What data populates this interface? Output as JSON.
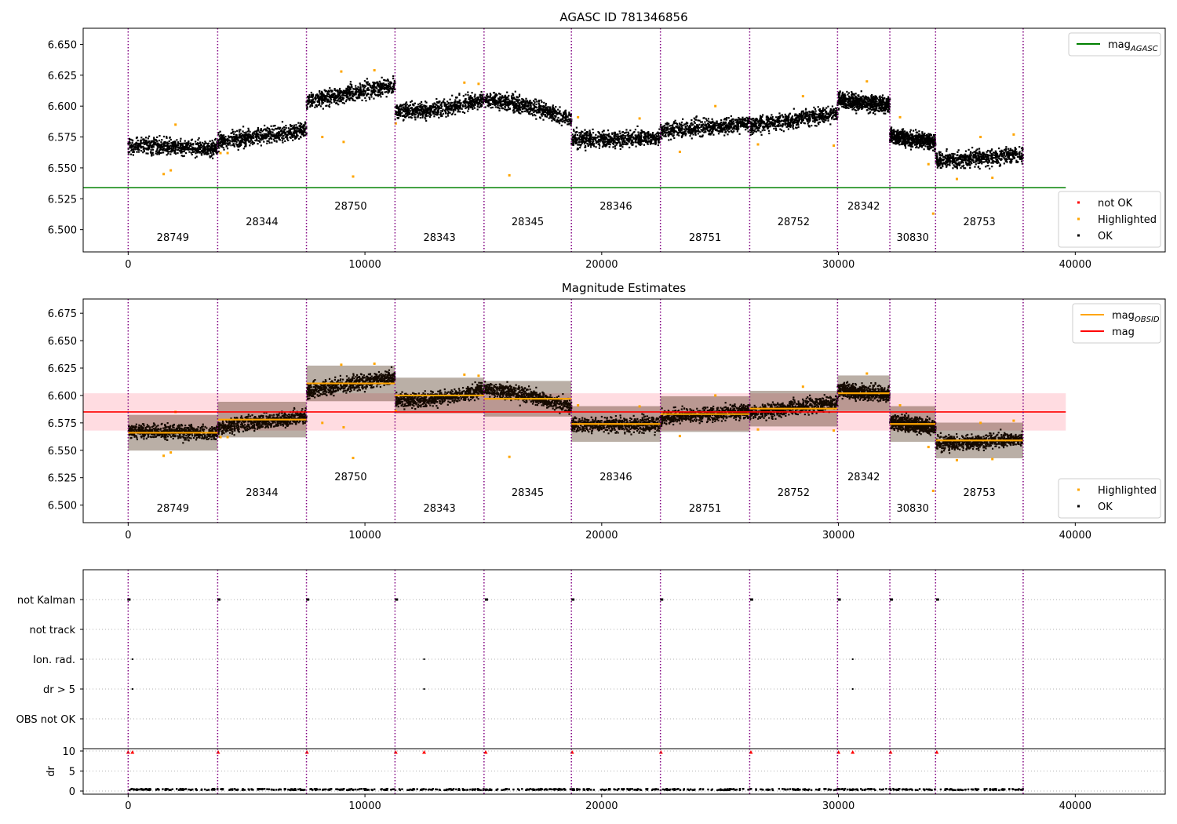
{
  "chart_data": [
    {
      "type": "scatter",
      "title": "AGASC ID 781346856",
      "xlim": [
        -1900,
        43800
      ],
      "ylim": [
        6.482,
        6.663
      ],
      "xticks": [
        0,
        10000,
        20000,
        30000,
        40000
      ],
      "yticks": [
        6.5,
        6.525,
        6.55,
        6.575,
        6.6,
        6.625,
        6.65
      ],
      "legend_upper": [
        {
          "label": "mag",
          "sub": "AGASC",
          "color": "#008000",
          "marker": "line"
        }
      ],
      "legend_lower": [
        {
          "label": "not OK",
          "color": "#ff0000",
          "marker": "dot"
        },
        {
          "label": "Highlighted",
          "color": "#ffa500",
          "marker": "dot"
        },
        {
          "label": "OK",
          "color": "#000000",
          "marker": "dot"
        }
      ],
      "reference_line": {
        "series": "mag_AGASC",
        "value": 6.534,
        "x_range": [
          -1900,
          39600
        ],
        "color": "#008000"
      }
    },
    {
      "type": "scatter",
      "title": "Magnitude Estimates",
      "xlim": [
        -1900,
        43800
      ],
      "ylim": [
        6.484,
        6.688
      ],
      "xticks": [
        0,
        10000,
        20000,
        30000,
        40000
      ],
      "yticks": [
        6.5,
        6.525,
        6.55,
        6.575,
        6.6,
        6.625,
        6.65,
        6.675
      ],
      "legend_upper": [
        {
          "label": "mag",
          "sub": "OBSID",
          "color": "#ffa500",
          "marker": "line"
        },
        {
          "label": "mag",
          "sub": "",
          "color": "#ff0000",
          "marker": "line"
        }
      ],
      "legend_lower": [
        {
          "label": "Highlighted",
          "color": "#ffa500",
          "marker": "dot"
        },
        {
          "label": "OK",
          "color": "#000000",
          "marker": "dot"
        }
      ],
      "mean_mag": {
        "value": 6.585,
        "band": [
          6.568,
          6.602
        ],
        "x_range": [
          -1900,
          39600
        ],
        "color": "#ff0000",
        "band_color": "#ffc0c8"
      }
    },
    {
      "type": "scatter",
      "title": "",
      "xlim": [
        -1900,
        43800
      ],
      "flag_labels": [
        "not Kalman",
        "not track",
        "Ion. rad.",
        "dr > 5",
        "OBS not OK"
      ],
      "dr_label": "dr",
      "dr_yticks": [
        0,
        5,
        10
      ],
      "xticks": [
        0,
        10000,
        20000,
        30000,
        40000
      ],
      "flags_not_kalman_x": [
        0,
        3800,
        7550,
        11300,
        15100,
        18750,
        22500,
        26300,
        30000,
        32200,
        34150
      ],
      "flags_ion_rad_x": [
        180,
        12500,
        30600
      ],
      "flags_dr_gt5_x": [
        180,
        12500,
        30600
      ],
      "dr_high_points_x": [
        0,
        180,
        3800,
        7550,
        11300,
        12500,
        15100,
        18750,
        22500,
        26300,
        30000,
        30600,
        32200,
        34150
      ]
    }
  ],
  "obsids": [
    {
      "id": "28749",
      "start": 0,
      "end": 3780,
      "mag": 6.566,
      "y0": 6.568,
      "y1": 6.566,
      "curve": 0,
      "spread": 0.0065,
      "label_level": 0
    },
    {
      "id": "28344",
      "start": 3780,
      "end": 7530,
      "mag": 6.578,
      "y0": 6.571,
      "y1": 6.581,
      "curve": 0,
      "spread": 0.0065,
      "label_level": 1
    },
    {
      "id": "28750",
      "start": 7530,
      "end": 11270,
      "mag": 6.611,
      "y0": 6.604,
      "y1": 6.617,
      "curve": 0,
      "spread": 0.0065,
      "label_level": 2
    },
    {
      "id": "28343",
      "start": 11270,
      "end": 15030,
      "mag": 6.6,
      "y0": 6.596,
      "y1": 6.606,
      "curve": -0.003,
      "spread": 0.0065,
      "label_level": 0
    },
    {
      "id": "28345",
      "start": 15030,
      "end": 18720,
      "mag": 6.597,
      "y0": 6.605,
      "y1": 6.589,
      "curve": 0.003,
      "spread": 0.0065,
      "label_level": 1
    },
    {
      "id": "28346",
      "start": 18720,
      "end": 22480,
      "mag": 6.574,
      "y0": 6.573,
      "y1": 6.574,
      "curve": 0,
      "spread": 0.0065,
      "label_level": 2
    },
    {
      "id": "28751",
      "start": 22480,
      "end": 26250,
      "mag": 6.583,
      "y0": 6.58,
      "y1": 6.586,
      "curve": 0,
      "spread": 0.0065,
      "label_level": 0
    },
    {
      "id": "28752",
      "start": 26250,
      "end": 29960,
      "mag": 6.588,
      "y0": 6.584,
      "y1": 6.594,
      "curve": 0,
      "spread": 0.0065,
      "label_level": 1
    },
    {
      "id": "28342",
      "start": 29960,
      "end": 32170,
      "mag": 6.602,
      "y0": 6.605,
      "y1": 6.601,
      "curve": 0,
      "spread": 0.0065,
      "label_level": 2
    },
    {
      "id": "30830",
      "start": 32170,
      "end": 34100,
      "mag": 6.574,
      "y0": 6.576,
      "y1": 6.571,
      "curve": 0,
      "spread": 0.0065,
      "label_level": 0
    },
    {
      "id": "28753",
      "start": 34100,
      "end": 37800,
      "mag": 6.559,
      "y0": 6.556,
      "y1": 6.56,
      "curve": 0,
      "spread": 0.0065,
      "label_level": 1
    }
  ],
  "highlighted_points": [
    [
      1500,
      6.545
    ],
    [
      1800,
      6.548
    ],
    [
      2000,
      6.585
    ],
    [
      3900,
      6.562
    ],
    [
      4200,
      6.562
    ],
    [
      8200,
      6.575
    ],
    [
      9100,
      6.571
    ],
    [
      9500,
      6.543
    ],
    [
      9000,
      6.628
    ],
    [
      10400,
      6.629
    ],
    [
      11300,
      6.586
    ],
    [
      14200,
      6.619
    ],
    [
      14800,
      6.618
    ],
    [
      16100,
      6.544
    ],
    [
      19000,
      6.591
    ],
    [
      21600,
      6.59
    ],
    [
      23300,
      6.563
    ],
    [
      24800,
      6.6
    ],
    [
      26600,
      6.569
    ],
    [
      28500,
      6.608
    ],
    [
      29800,
      6.568
    ],
    [
      31200,
      6.62
    ],
    [
      32600,
      6.591
    ],
    [
      33800,
      6.553
    ],
    [
      34000,
      6.513
    ],
    [
      35000,
      6.541
    ],
    [
      36000,
      6.575
    ],
    [
      36500,
      6.542
    ],
    [
      37400,
      6.577
    ]
  ],
  "colors": {
    "ok": "#000000",
    "highlighted": "#ffa500",
    "not_ok": "#ff0000",
    "obsid_line": "#800080",
    "agasc": "#008000",
    "mean": "#ff0000",
    "band": "#ffc0c8",
    "grid": "#b0b0b0"
  }
}
